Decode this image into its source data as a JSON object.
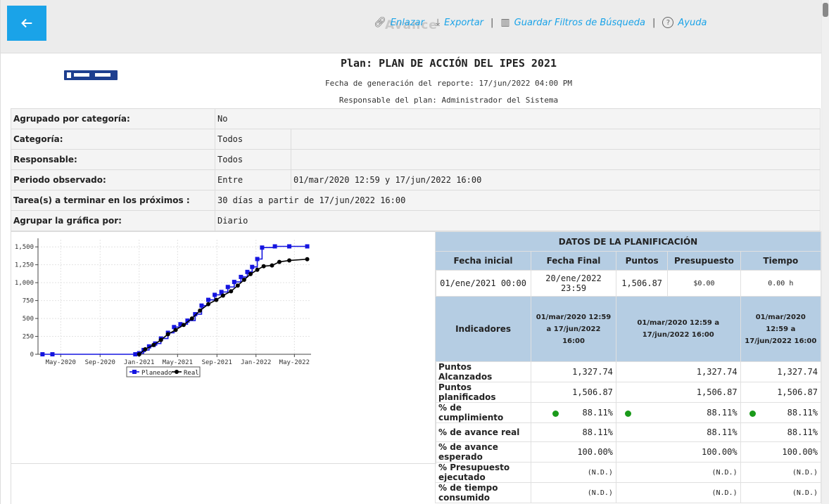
{
  "toolbar": {
    "link_label": "Enlazar",
    "export_label": "Exportar",
    "save_filters_label": "Guardar Filtros de Búsqueda",
    "help_label": "Ayuda",
    "separator": "|",
    "watermark": "Avance"
  },
  "report": {
    "title": "Plan:  PLAN DE ACCIÓN DEL IPES 2021",
    "generated": "Fecha de generación del reporte:  17/jun/2022 04:00 PM",
    "owner": "Responsable del plan: Administrador del Sistema"
  },
  "filters": {
    "grouped_label": "Agrupado por categoría:",
    "grouped_value": "No",
    "category_label": "Categoría:",
    "category_value": "Todos",
    "responsible_label": "Responsable:",
    "responsible_value": "Todos",
    "period_label": "Periodo observado:",
    "period_mode": "Entre",
    "period_value": "01/mar/2020 12:59 y 17/jun/2022 16:00",
    "tasks_label": "Tarea(s) a terminar en los próximos :",
    "tasks_value": "30 días a partir de 17/jun/2022 16:00",
    "group_chart_label": "Agrupar la gráfica por:",
    "group_chart_value": "Diario"
  },
  "planning": {
    "section_title": "DATOS DE LA PLANIFICACIÓN",
    "headers": {
      "start": "Fecha inicial",
      "end": "Fecha Final",
      "points": "Puntos",
      "budget": "Presupuesto",
      "time": "Tiempo"
    },
    "values": {
      "start": "01/ene/2021 00:00",
      "end": "20/ene/2022 23:59",
      "points": "1,506.87",
      "budget": "$0.00",
      "time": "0.00 h"
    },
    "indicators_label": "Indicadores",
    "periods": [
      "01/mar/2020 12:59 a 17/jun/2022 16:00",
      "01/mar/2020 12:59 a 17/jun/2022 16:00",
      "01/mar/2020 12:59 a 17/jun/2022 16:00"
    ],
    "rows": [
      {
        "label": "Puntos Alcanzados",
        "values": [
          "1,327.74",
          "1,327.74",
          "1,327.74"
        ]
      },
      {
        "label": "Puntos planificados",
        "values": [
          "1,506.87",
          "1,506.87",
          "1,506.87"
        ]
      },
      {
        "label": "% de cumplimiento",
        "values": [
          "88.11%",
          "88.11%",
          "88.11%"
        ]
      },
      {
        "label": "% de avance real",
        "values": [
          "88.11%",
          "88.11%",
          "88.11%"
        ]
      },
      {
        "label": "% de avance esperado",
        "values": [
          "100.00%",
          "100.00%",
          "100.00%"
        ]
      },
      {
        "label": "% Presupuesto ejecutado",
        "values": [
          "(N.D.)",
          "(N.D.)",
          "(N.D.)"
        ]
      },
      {
        "label": "% de tiempo consumido",
        "values": [
          "(N.D.)",
          "(N.D.)",
          "(N.D.)"
        ]
      }
    ],
    "status_color": "#1a9a1a"
  },
  "colors": {
    "accent": "#1aa3e8",
    "planned": "#1515e0",
    "real": "#000000",
    "table_header": "#b5cde3"
  },
  "chart_data": {
    "type": "line",
    "x_ticks": [
      "May-2020",
      "Sep-2020",
      "Jan-2021",
      "May-2021",
      "Sep-2021",
      "Jan-2022",
      "May-2022"
    ],
    "y_ticks": [
      "0",
      "250",
      "500",
      "750",
      "1,000",
      "1,250",
      "1,500"
    ],
    "ylim": [
      0,
      1600
    ],
    "legend": [
      "Planeado",
      "Real"
    ],
    "legend_position": "bottom-center",
    "grid": true,
    "series": [
      {
        "name": "Planeado",
        "marker": "square",
        "points": [
          [
            "2020-03-05",
            0
          ],
          [
            "2020-04-05",
            0
          ],
          [
            "2020-12-20",
            0
          ],
          [
            "2021-01-01",
            15
          ],
          [
            "2021-01-15",
            60
          ],
          [
            "2021-02-01",
            110
          ],
          [
            "2021-02-20",
            150
          ],
          [
            "2021-03-10",
            220
          ],
          [
            "2021-04-01",
            300
          ],
          [
            "2021-04-20",
            380
          ],
          [
            "2021-05-10",
            420
          ],
          [
            "2021-06-01",
            470
          ],
          [
            "2021-06-25",
            560
          ],
          [
            "2021-07-15",
            680
          ],
          [
            "2021-08-05",
            760
          ],
          [
            "2021-08-25",
            830
          ],
          [
            "2021-09-15",
            870
          ],
          [
            "2021-10-05",
            940
          ],
          [
            "2021-10-25",
            1010
          ],
          [
            "2021-11-15",
            1080
          ],
          [
            "2021-12-05",
            1150
          ],
          [
            "2021-12-20",
            1220
          ],
          [
            "2022-01-05",
            1330
          ],
          [
            "2022-01-20",
            1490
          ],
          [
            "2022-03-01",
            1506.87
          ],
          [
            "2022-04-15",
            1506.87
          ],
          [
            "2022-06-10",
            1506.87
          ]
        ]
      },
      {
        "name": "Real",
        "marker": "circle",
        "points": [
          [
            "2021-01-01",
            0
          ],
          [
            "2021-01-20",
            70
          ],
          [
            "2021-02-15",
            130
          ],
          [
            "2021-03-10",
            200
          ],
          [
            "2021-04-01",
            280
          ],
          [
            "2021-04-25",
            340
          ],
          [
            "2021-05-20",
            410
          ],
          [
            "2021-06-15",
            500
          ],
          [
            "2021-07-10",
            610
          ],
          [
            "2021-08-05",
            700
          ],
          [
            "2021-08-30",
            760
          ],
          [
            "2021-09-20",
            820
          ],
          [
            "2021-10-15",
            880
          ],
          [
            "2021-11-05",
            960
          ],
          [
            "2021-11-25",
            1040
          ],
          [
            "2021-12-15",
            1120
          ],
          [
            "2022-01-05",
            1180
          ],
          [
            "2022-01-25",
            1230
          ],
          [
            "2022-02-20",
            1240
          ],
          [
            "2022-03-15",
            1290
          ],
          [
            "2022-04-15",
            1310
          ],
          [
            "2022-06-10",
            1327.74
          ]
        ]
      }
    ]
  }
}
